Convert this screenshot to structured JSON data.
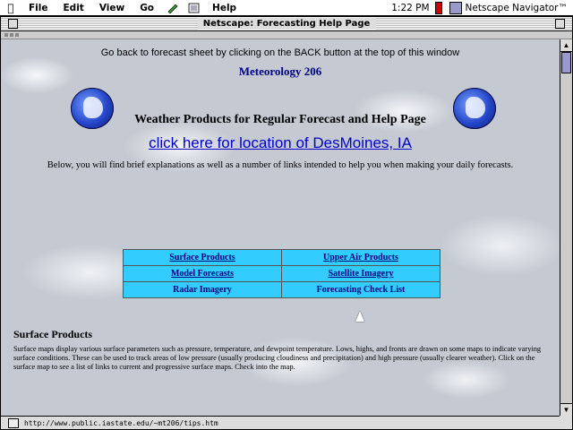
{
  "menubar": {
    "apple": "",
    "items": [
      "File",
      "Edit",
      "View",
      "Go",
      "Help"
    ],
    "clock": "1:22 PM",
    "app_name": "Netscape Navigator™"
  },
  "window": {
    "title": "Netscape: Forecasting Help Page"
  },
  "page": {
    "back_msg": "Go back to forecast sheet by clicking on the BACK button at the top of this window",
    "course": "Meteorology 206",
    "heading": "Weather Products for Regular Forecast and Help Page",
    "location_link": "click here for location of  DesMoines, IA",
    "intro": "Below, you will find brief explanations as well as a number of links intended to help you when making your daily forecasts.",
    "nav": [
      [
        "Surface Products",
        "Upper Air Products"
      ],
      [
        "Model Forecasts",
        "Satellite Imagery"
      ],
      [
        "Radar Imagery",
        "Forecasting Check List"
      ]
    ],
    "section_title": "Surface Products",
    "section_body": "Surface maps display various surface parameters such as pressure, temperature, and dewpoint temperature. Lows, highs, and fronts are drawn on some maps to indicate varying surface conditions. These can be used to track areas of low pressure (usually producing cloudiness and precipitation) and high pressure (usually clearer weather). Click on the surface map to see a list of links to current and progressive surface maps.   Check into the map."
  },
  "status": {
    "url": "http://www.public.iastate.edu/~mt206/tips.htm"
  },
  "colors": {
    "link": "#0000cc",
    "nav_cell": "#33ccff",
    "course": "#000080"
  }
}
